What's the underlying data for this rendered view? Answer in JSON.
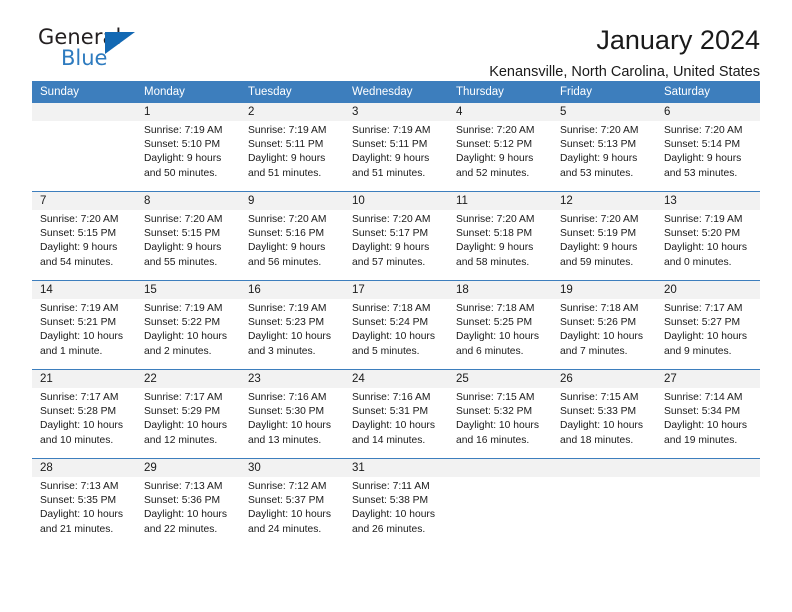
{
  "logo": {
    "word_one": "General",
    "word_two": "Blue",
    "triangle_icon": "blue-triangle-icon",
    "brand_blue": "#1268b3",
    "brand_text_blue": "#2e7bbf"
  },
  "header": {
    "title": "January 2024",
    "subtitle": "Kenansville, North Carolina, United States"
  },
  "calendar": {
    "header_color": "#3d7ebd",
    "day_number_band_color": "#f2f2f2",
    "weekdays": [
      "Sunday",
      "Monday",
      "Tuesday",
      "Wednesday",
      "Thursday",
      "Friday",
      "Saturday"
    ],
    "labels": {
      "sunrise": "Sunrise:",
      "sunset": "Sunset:",
      "daylight": "Daylight:"
    },
    "weeks": [
      [
        {
          "day": "",
          "empty": true
        },
        {
          "day": "1",
          "sunrise": "Sunrise: 7:19 AM",
          "sunset": "Sunset: 5:10 PM",
          "daylight_line1": "Daylight: 9 hours",
          "daylight_line2": "and 50 minutes."
        },
        {
          "day": "2",
          "sunrise": "Sunrise: 7:19 AM",
          "sunset": "Sunset: 5:11 PM",
          "daylight_line1": "Daylight: 9 hours",
          "daylight_line2": "and 51 minutes."
        },
        {
          "day": "3",
          "sunrise": "Sunrise: 7:19 AM",
          "sunset": "Sunset: 5:11 PM",
          "daylight_line1": "Daylight: 9 hours",
          "daylight_line2": "and 51 minutes."
        },
        {
          "day": "4",
          "sunrise": "Sunrise: 7:20 AM",
          "sunset": "Sunset: 5:12 PM",
          "daylight_line1": "Daylight: 9 hours",
          "daylight_line2": "and 52 minutes."
        },
        {
          "day": "5",
          "sunrise": "Sunrise: 7:20 AM",
          "sunset": "Sunset: 5:13 PM",
          "daylight_line1": "Daylight: 9 hours",
          "daylight_line2": "and 53 minutes."
        },
        {
          "day": "6",
          "sunrise": "Sunrise: 7:20 AM",
          "sunset": "Sunset: 5:14 PM",
          "daylight_line1": "Daylight: 9 hours",
          "daylight_line2": "and 53 minutes."
        }
      ],
      [
        {
          "day": "7",
          "sunrise": "Sunrise: 7:20 AM",
          "sunset": "Sunset: 5:15 PM",
          "daylight_line1": "Daylight: 9 hours",
          "daylight_line2": "and 54 minutes."
        },
        {
          "day": "8",
          "sunrise": "Sunrise: 7:20 AM",
          "sunset": "Sunset: 5:15 PM",
          "daylight_line1": "Daylight: 9 hours",
          "daylight_line2": "and 55 minutes."
        },
        {
          "day": "9",
          "sunrise": "Sunrise: 7:20 AM",
          "sunset": "Sunset: 5:16 PM",
          "daylight_line1": "Daylight: 9 hours",
          "daylight_line2": "and 56 minutes."
        },
        {
          "day": "10",
          "sunrise": "Sunrise: 7:20 AM",
          "sunset": "Sunset: 5:17 PM",
          "daylight_line1": "Daylight: 9 hours",
          "daylight_line2": "and 57 minutes."
        },
        {
          "day": "11",
          "sunrise": "Sunrise: 7:20 AM",
          "sunset": "Sunset: 5:18 PM",
          "daylight_line1": "Daylight: 9 hours",
          "daylight_line2": "and 58 minutes."
        },
        {
          "day": "12",
          "sunrise": "Sunrise: 7:20 AM",
          "sunset": "Sunset: 5:19 PM",
          "daylight_line1": "Daylight: 9 hours",
          "daylight_line2": "and 59 minutes."
        },
        {
          "day": "13",
          "sunrise": "Sunrise: 7:19 AM",
          "sunset": "Sunset: 5:20 PM",
          "daylight_line1": "Daylight: 10 hours",
          "daylight_line2": "and 0 minutes."
        }
      ],
      [
        {
          "day": "14",
          "sunrise": "Sunrise: 7:19 AM",
          "sunset": "Sunset: 5:21 PM",
          "daylight_line1": "Daylight: 10 hours",
          "daylight_line2": "and 1 minute."
        },
        {
          "day": "15",
          "sunrise": "Sunrise: 7:19 AM",
          "sunset": "Sunset: 5:22 PM",
          "daylight_line1": "Daylight: 10 hours",
          "daylight_line2": "and 2 minutes."
        },
        {
          "day": "16",
          "sunrise": "Sunrise: 7:19 AM",
          "sunset": "Sunset: 5:23 PM",
          "daylight_line1": "Daylight: 10 hours",
          "daylight_line2": "and 3 minutes."
        },
        {
          "day": "17",
          "sunrise": "Sunrise: 7:18 AM",
          "sunset": "Sunset: 5:24 PM",
          "daylight_line1": "Daylight: 10 hours",
          "daylight_line2": "and 5 minutes."
        },
        {
          "day": "18",
          "sunrise": "Sunrise: 7:18 AM",
          "sunset": "Sunset: 5:25 PM",
          "daylight_line1": "Daylight: 10 hours",
          "daylight_line2": "and 6 minutes."
        },
        {
          "day": "19",
          "sunrise": "Sunrise: 7:18 AM",
          "sunset": "Sunset: 5:26 PM",
          "daylight_line1": "Daylight: 10 hours",
          "daylight_line2": "and 7 minutes."
        },
        {
          "day": "20",
          "sunrise": "Sunrise: 7:17 AM",
          "sunset": "Sunset: 5:27 PM",
          "daylight_line1": "Daylight: 10 hours",
          "daylight_line2": "and 9 minutes."
        }
      ],
      [
        {
          "day": "21",
          "sunrise": "Sunrise: 7:17 AM",
          "sunset": "Sunset: 5:28 PM",
          "daylight_line1": "Daylight: 10 hours",
          "daylight_line2": "and 10 minutes."
        },
        {
          "day": "22",
          "sunrise": "Sunrise: 7:17 AM",
          "sunset": "Sunset: 5:29 PM",
          "daylight_line1": "Daylight: 10 hours",
          "daylight_line2": "and 12 minutes."
        },
        {
          "day": "23",
          "sunrise": "Sunrise: 7:16 AM",
          "sunset": "Sunset: 5:30 PM",
          "daylight_line1": "Daylight: 10 hours",
          "daylight_line2": "and 13 minutes."
        },
        {
          "day": "24",
          "sunrise": "Sunrise: 7:16 AM",
          "sunset": "Sunset: 5:31 PM",
          "daylight_line1": "Daylight: 10 hours",
          "daylight_line2": "and 14 minutes."
        },
        {
          "day": "25",
          "sunrise": "Sunrise: 7:15 AM",
          "sunset": "Sunset: 5:32 PM",
          "daylight_line1": "Daylight: 10 hours",
          "daylight_line2": "and 16 minutes."
        },
        {
          "day": "26",
          "sunrise": "Sunrise: 7:15 AM",
          "sunset": "Sunset: 5:33 PM",
          "daylight_line1": "Daylight: 10 hours",
          "daylight_line2": "and 18 minutes."
        },
        {
          "day": "27",
          "sunrise": "Sunrise: 7:14 AM",
          "sunset": "Sunset: 5:34 PM",
          "daylight_line1": "Daylight: 10 hours",
          "daylight_line2": "and 19 minutes."
        }
      ],
      [
        {
          "day": "28",
          "sunrise": "Sunrise: 7:13 AM",
          "sunset": "Sunset: 5:35 PM",
          "daylight_line1": "Daylight: 10 hours",
          "daylight_line2": "and 21 minutes."
        },
        {
          "day": "29",
          "sunrise": "Sunrise: 7:13 AM",
          "sunset": "Sunset: 5:36 PM",
          "daylight_line1": "Daylight: 10 hours",
          "daylight_line2": "and 22 minutes."
        },
        {
          "day": "30",
          "sunrise": "Sunrise: 7:12 AM",
          "sunset": "Sunset: 5:37 PM",
          "daylight_line1": "Daylight: 10 hours",
          "daylight_line2": "and 24 minutes."
        },
        {
          "day": "31",
          "sunrise": "Sunrise: 7:11 AM",
          "sunset": "Sunset: 5:38 PM",
          "daylight_line1": "Daylight: 10 hours",
          "daylight_line2": "and 26 minutes."
        },
        {
          "day": "",
          "empty": true
        },
        {
          "day": "",
          "empty": true
        },
        {
          "day": "",
          "empty": true
        }
      ]
    ]
  }
}
